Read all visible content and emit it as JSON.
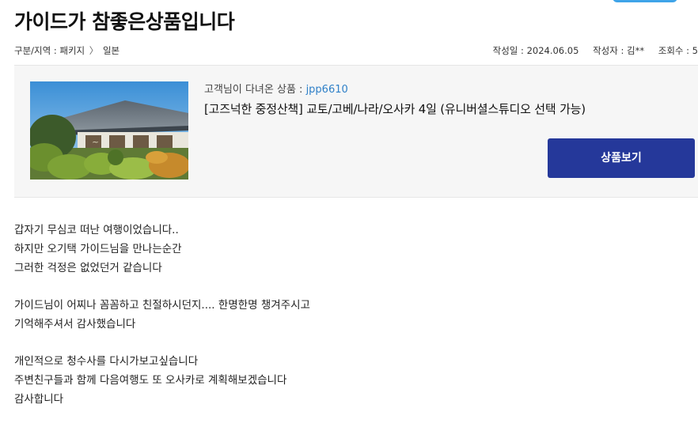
{
  "page": {
    "title": "가이드가 참좋은상품입니다"
  },
  "meta": {
    "category_prefix": "구분/지역 : 패키지",
    "category_separator": "〉",
    "category_region": "일본",
    "date": "작성일 : 2024.06.05",
    "author": "작성자 : 김**",
    "views": "조회수 : 5"
  },
  "product": {
    "code_label": "고객님이 다녀온 상품 : ",
    "code": "jpp6610",
    "name": "[고즈넉한 중정산책] 교토/고베/나라/오사카 4일 (유니버셜스튜디오 선택 가능)",
    "button_label": "상품보기",
    "button_color": "#25389a",
    "image_icon": "japanese-garden-photo"
  },
  "body": {
    "paragraphs": [
      [
        "갑자기 무심코 떠난 여행이었습니다..",
        "하지만 오기택 가이드님을 만나는순간",
        "그러한 걱정은 없었던거 같습니다"
      ],
      [
        "가이드님이 어찌나 꼼꼼하고 친절하시던지.... 한명한명 챙겨주시고",
        "기억해주셔서 감사했습니다"
      ],
      [
        "개인적으로 청수사를 다시가보고싶습니다",
        "주변친구들과 함께 다음여행도 또 오사카로 계획해보겠습니다",
        "감사합니다"
      ]
    ]
  }
}
